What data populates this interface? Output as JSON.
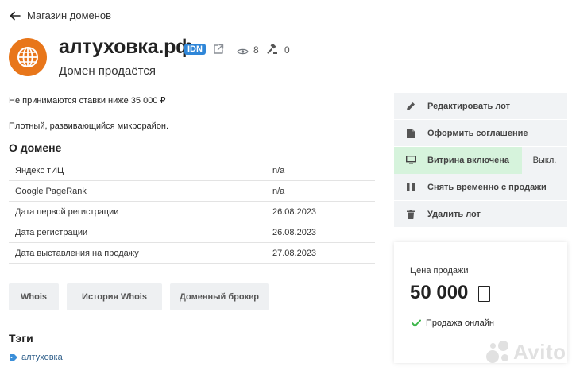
{
  "nav": {
    "back_label": "Магазин доменов"
  },
  "domain": {
    "name": "алтуховка.рф",
    "idn_badge": "IDN",
    "views": "8",
    "bids": "0",
    "status": "Домен продаётся"
  },
  "notes": {
    "min_bid": "Не принимаются ставки ниже 35 000 ₽",
    "description": "Плотный, развивающийся микрорайон."
  },
  "about": {
    "title": "О домене",
    "rows": [
      {
        "key": "Яндекс тИЦ",
        "value": "n/a"
      },
      {
        "key": "Google PageRank",
        "value": "n/a"
      },
      {
        "key": "Дата первой регистрации",
        "value": "26.08.2023"
      },
      {
        "key": "Дата регистрации",
        "value": "26.08.2023"
      },
      {
        "key": "Дата выставления на продажу",
        "value": "27.08.2023"
      }
    ]
  },
  "buttons": {
    "whois": "Whois",
    "whois_history": "История Whois",
    "broker": "Доменный брокер"
  },
  "tags": {
    "title": "Тэги",
    "items": [
      "алтуховка"
    ]
  },
  "actions": {
    "edit": "Редактировать лот",
    "agreement": "Оформить соглашение",
    "showcase": "Витрина включена",
    "showcase_off": "Выкл.",
    "pause": "Снять временно с продажи",
    "delete": "Удалить лот"
  },
  "price": {
    "label": "Цена продажи",
    "value": "50 000",
    "online": "Продажа онлайн"
  },
  "watermark": "Avito",
  "colors": {
    "globe": "#e8761a",
    "idn_badge": "#2f86d8",
    "showcase_on": "#d6f3dc",
    "check": "#3cb54a"
  }
}
